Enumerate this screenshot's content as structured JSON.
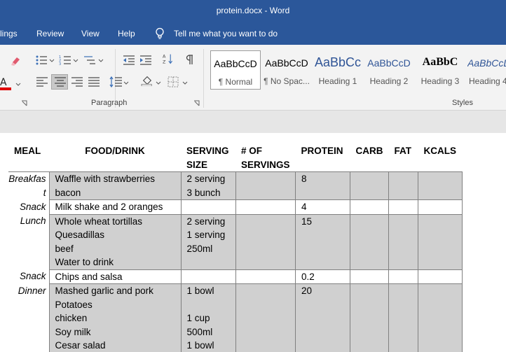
{
  "window": {
    "title": "protein.docx  -  Word"
  },
  "menu": {
    "items": [
      "lings",
      "Review",
      "View",
      "Help"
    ],
    "tell_me": "Tell me what you want to do"
  },
  "ribbon": {
    "paragraph_label": "Paragraph",
    "styles_label": "Styles",
    "styles": [
      {
        "sample": "AaBbCcD",
        "name": "¶ Normal"
      },
      {
        "sample": "AaBbCcD",
        "name": "¶ No Spac..."
      },
      {
        "sample": "AaBbCc",
        "name": "Heading 1"
      },
      {
        "sample": "AaBbCcD",
        "name": "Heading 2"
      },
      {
        "sample": "AaBbC",
        "name": "Heading 3"
      },
      {
        "sample": "AaBbCcD",
        "name": "Heading 4"
      }
    ]
  },
  "colors": {
    "title_bar": "#2b579a",
    "ribbon_bg": "#f3f3f3",
    "heading_blue": "#2f5496",
    "shaded_cell": "#d0d0d0",
    "font_color_red": "#e00000"
  },
  "icons": [
    "format-painter-icon",
    "bullets-icon",
    "numbering-icon",
    "multilevel-list-icon",
    "decrease-indent-icon",
    "increase-indent-icon",
    "sort-icon",
    "show-formatting-icon",
    "align-left-icon",
    "align-center-icon",
    "align-right-icon",
    "justify-icon",
    "line-spacing-icon",
    "shading-icon",
    "borders-icon",
    "lightbulb-icon",
    "dialog-launcher-icon"
  ],
  "table": {
    "headers": [
      "MEAL",
      "FOOD/DRINK",
      "SERVING SIZE",
      "# OF SERVINGS",
      "PROTEIN",
      "CARB",
      "FAT",
      "KCALS"
    ],
    "rows": [
      {
        "meal": "Breakfast",
        "food": [
          "Waffle with strawberries",
          "bacon"
        ],
        "serving": [
          "2 serving",
          "3 bunch"
        ],
        "servings": [],
        "protein": [
          "8"
        ],
        "carb": [],
        "fat": [],
        "kcals": []
      },
      {
        "meal": "Snack",
        "food": [
          "Milk shake and 2 oranges"
        ],
        "serving": [],
        "servings": [],
        "protein": [
          "4"
        ],
        "carb": [],
        "fat": [],
        "kcals": []
      },
      {
        "meal": "Lunch",
        "food": [
          "Whole wheat tortillas",
          "Quesadillas",
          "beef",
          "Water to drink"
        ],
        "serving": [
          "2 serving",
          "1 serving",
          "250ml",
          ""
        ],
        "servings": [],
        "protein": [
          "15"
        ],
        "carb": [],
        "fat": [],
        "kcals": []
      },
      {
        "meal": "Snack",
        "food": [
          "Chips and salsa"
        ],
        "serving": [],
        "servings": [],
        "protein": [
          "0.2"
        ],
        "carb": [],
        "fat": [],
        "kcals": []
      },
      {
        "meal": "Dinner",
        "food": [
          "Mashed garlic and pork",
          "Potatoes",
          "chicken",
          "Soy milk",
          "Cesar salad"
        ],
        "serving": [
          "1 bowl",
          "",
          "1 cup",
          "500ml",
          "1 bowl"
        ],
        "servings": [],
        "protein": [
          "20"
        ],
        "carb": [],
        "fat": [],
        "kcals": []
      }
    ]
  }
}
